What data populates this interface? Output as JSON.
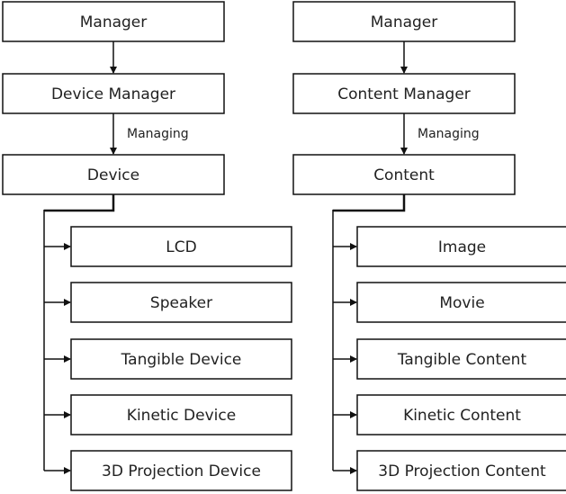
{
  "left": {
    "top": "Manager",
    "manager": "Device Manager",
    "edge_label": "Managing",
    "root": "Device",
    "children": [
      "LCD",
      "Speaker",
      "Tangible Device",
      "Kinetic Device",
      "3D Projection Device"
    ]
  },
  "right": {
    "top": "Manager",
    "manager": "Content Manager",
    "edge_label": "Managing",
    "root": "Content",
    "children": [
      "Image",
      "Movie",
      "Tangible Content",
      "Kinetic Content",
      "3D Projection Content"
    ]
  }
}
